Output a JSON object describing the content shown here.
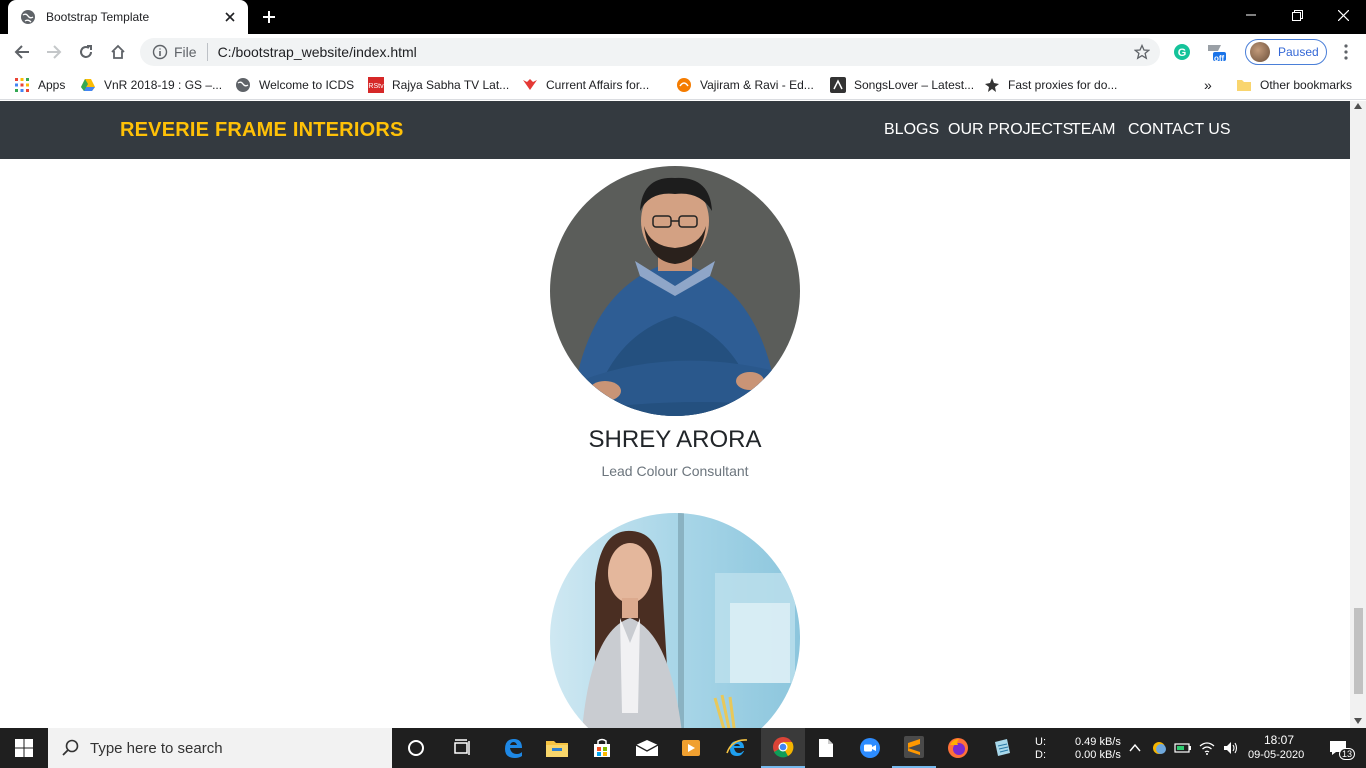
{
  "browser": {
    "tab_title": "Bootstrap Template",
    "url_scheme": "File",
    "url": "C:/bootstrap_website/index.html",
    "profile_label": "Paused",
    "extension_badge": "off"
  },
  "bookmarks": {
    "items": [
      {
        "label": "Apps",
        "icon": "apps-grid-icon"
      },
      {
        "label": "VnR 2018-19 : GS –...",
        "icon": "drive-icon"
      },
      {
        "label": "Welcome to ICDS",
        "icon": "globe-icon"
      },
      {
        "label": "Rajya Sabha TV Lat...",
        "icon": "rstv-icon"
      },
      {
        "label": "Current Affairs for...",
        "icon": "current-affairs-icon"
      },
      {
        "label": "Vajiram & Ravi - Ed...",
        "icon": "vajiram-icon"
      },
      {
        "label": "SongsLover – Latest...",
        "icon": "songslover-icon"
      },
      {
        "label": "Fast proxies for do...",
        "icon": "proxy-icon"
      }
    ],
    "overflow": "»",
    "other": "Other bookmarks"
  },
  "site": {
    "brand": "REVERIE FRAME INTERIORS",
    "nav": [
      "BLOGS",
      "OUR PROJECTS",
      "TEAM",
      "CONTACT US"
    ],
    "colors": {
      "navbar": "#343a40",
      "brand": "#ffc107"
    }
  },
  "team": [
    {
      "name": "SHREY ARORA",
      "role": "Lead Colour Consultant"
    },
    {
      "name": "",
      "role": ""
    }
  ],
  "taskbar": {
    "search_placeholder": "Type here to search",
    "net_up_label": "U:",
    "net_down_label": "D:",
    "net_up": "0.49 kB/s",
    "net_down": "0.00 kB/s",
    "time": "18:07",
    "date": "09-05-2020",
    "notifications": "13"
  }
}
